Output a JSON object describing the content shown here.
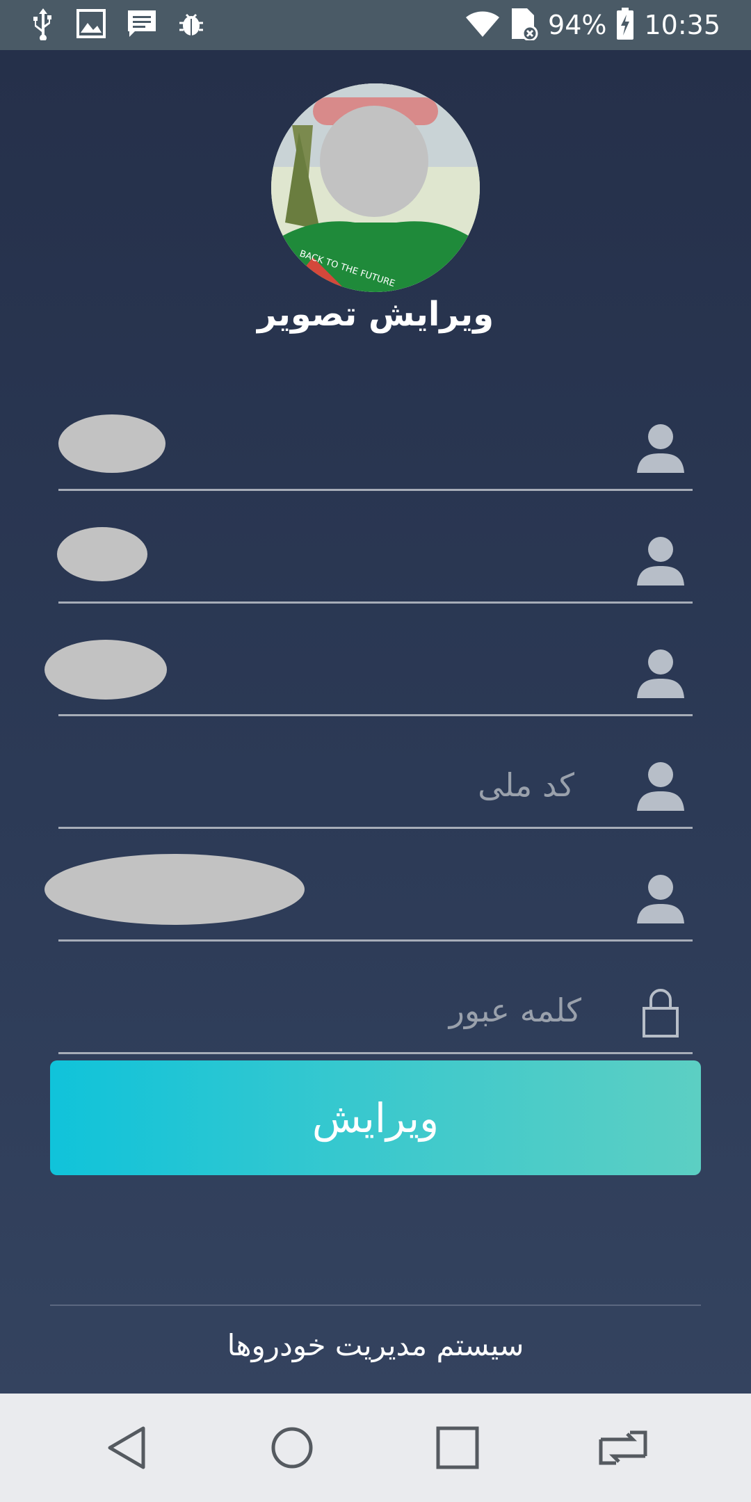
{
  "status_bar": {
    "battery": "94%",
    "time": "10:35",
    "icons": [
      "usb-icon",
      "image-icon",
      "message-icon",
      "bug-icon",
      "wifi-icon",
      "sim-off-icon",
      "battery-charging-icon"
    ]
  },
  "profile": {
    "edit_photo_label": "ویرایش تصویر",
    "photo_print_text": "BACK TO THE FUTURE"
  },
  "form": {
    "fields": [
      {
        "name": "first-name",
        "icon": "user-icon",
        "value": "",
        "placeholder": ""
      },
      {
        "name": "last-name",
        "icon": "user-icon",
        "value": "",
        "placeholder": ""
      },
      {
        "name": "field-3",
        "icon": "user-icon",
        "value": "",
        "placeholder": ""
      },
      {
        "name": "national-code",
        "icon": "user-icon",
        "value": "",
        "placeholder": "کد ملی"
      },
      {
        "name": "field-5",
        "icon": "user-icon",
        "value": "",
        "placeholder": ""
      },
      {
        "name": "password",
        "icon": "lock-icon",
        "value": "",
        "placeholder": "کلمه عبور"
      }
    ],
    "submit_label": "ویرایش"
  },
  "footer": {
    "text": "سیستم مدیریت خودروها"
  },
  "nav_bar": {
    "buttons": [
      "back-icon",
      "home-icon",
      "recents-icon",
      "switch-app-icon"
    ]
  },
  "colors": {
    "background_top": "#25304a",
    "background_bottom": "#34435f",
    "button_start": "#10c3da",
    "button_end": "#5ccfc3",
    "status_bar": "#4a5a66",
    "nav_bar": "#eaebee"
  }
}
